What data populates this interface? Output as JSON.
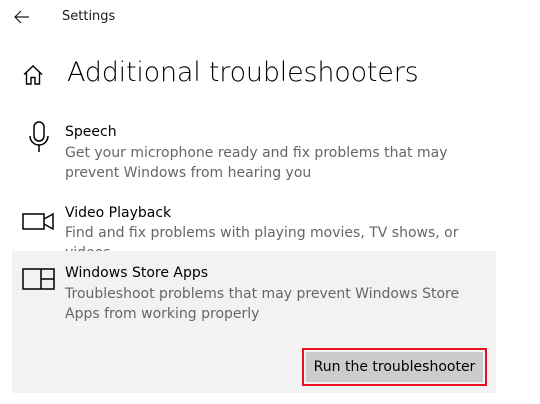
{
  "window": {
    "title": "Settings",
    "back_icon": "arrow-left-icon"
  },
  "header": {
    "home_icon": "home-icon",
    "title": "Additional troubleshooters"
  },
  "troubleshooters": [
    {
      "icon": "microphone-icon",
      "name": "Speech",
      "description": "Get your microphone ready and fix problems that may prevent Windows from hearing you"
    },
    {
      "icon": "video-camera-icon",
      "name": "Video Playback",
      "description": "Find and fix problems with playing movies, TV shows, or videos"
    },
    {
      "icon": "store-apps-icon",
      "name": "Windows Store Apps",
      "description": "Troubleshoot problems that may prevent Windows Store Apps from working properly",
      "selected": true,
      "action_label": "Run the troubleshooter"
    }
  ],
  "colors": {
    "selected_bg": "#f2f2f2",
    "button_bg": "#cccccc",
    "highlight_border": "#e81123",
    "description_text": "#666666"
  }
}
